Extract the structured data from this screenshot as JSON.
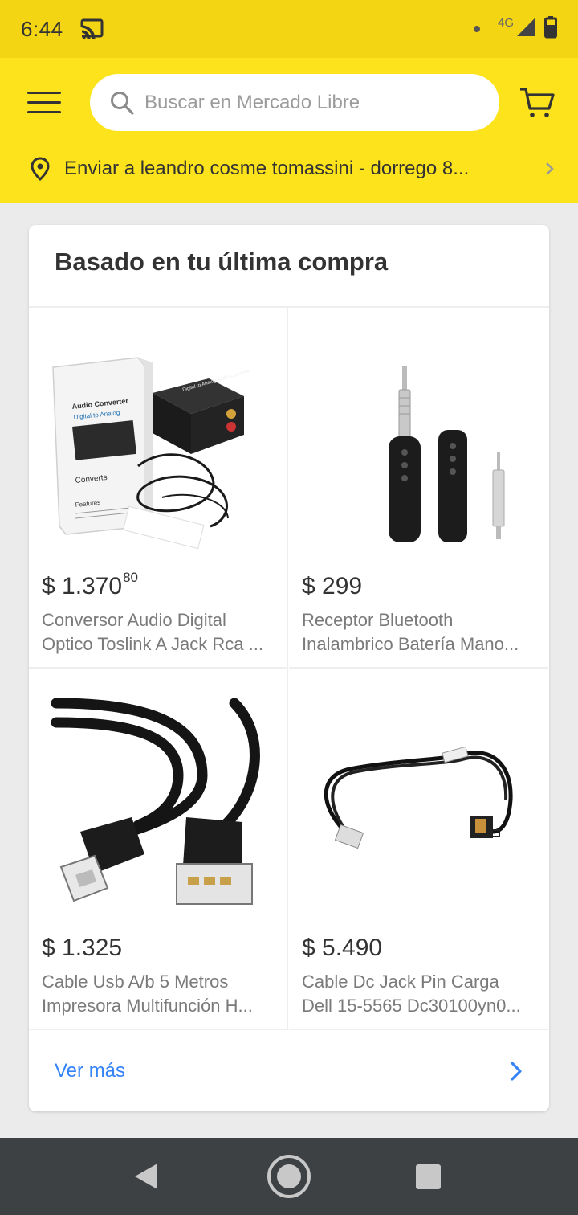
{
  "status_bar": {
    "time": "6:44",
    "network": "4G"
  },
  "header": {
    "search_placeholder": "Buscar en Mercado Libre",
    "address": "Enviar a leandro cosme tomassini - dorrego 8..."
  },
  "section": {
    "title": "Basado en tu última compra",
    "see_more": "Ver más"
  },
  "products": [
    {
      "price_main": "$ 1.370",
      "price_cents": "80",
      "title_line1": "Conversor Audio Digital",
      "title_line2": "Optico Toslink A Jack Rca ...",
      "box_text1": "Audio Converter",
      "box_text2": "Digital to Analog",
      "box_text3": "Converts",
      "box_text4": "Features",
      "device_text": "Digital to Analog Audio Converter"
    },
    {
      "price_main": "$ 299",
      "price_cents": "",
      "title_line1": "Receptor Bluetooth",
      "title_line2": "Inalambrico Batería Mano..."
    },
    {
      "price_main": "$ 1.325",
      "price_cents": "",
      "title_line1": "Cable Usb A/b 5 Metros",
      "title_line2": "Impresora Multifunción  H..."
    },
    {
      "price_main": "$ 5.490",
      "price_cents": "",
      "title_line1": "Cable Dc Jack Pin Carga",
      "title_line2": "Dell 15-5565 Dc30100yn0..."
    }
  ],
  "colors": {
    "header_yellow": "#fde31c",
    "link_blue": "#3483fa",
    "nav_bar": "#3d4144"
  },
  "icons": {
    "menu": "hamburger-icon",
    "search": "search-icon",
    "cart": "cart-icon",
    "location": "location-pin-icon",
    "cast": "cast-icon",
    "signal": "signal-icon",
    "battery": "battery-icon"
  }
}
